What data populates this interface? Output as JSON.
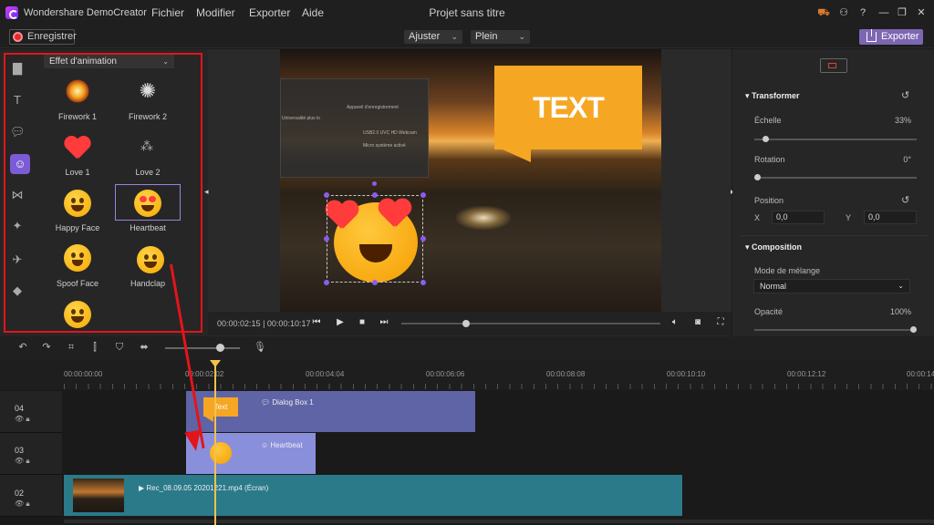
{
  "app": {
    "name": "Wondershare DemoCreator",
    "project_title": "Projet sans titre"
  },
  "menu": [
    "Fichier",
    "Modifier",
    "Exporter",
    "Aide"
  ],
  "toolbar": {
    "record_label": "Enregistrer",
    "fit_label": "Ajuster",
    "full_label": "Plein",
    "export_label": "Exporter"
  },
  "effects": {
    "category": "Effet d'animation",
    "items": [
      "Firework 1",
      "Firework 2",
      "Love 1",
      "Love 2",
      "Happy Face",
      "Heartbeat",
      "Spoof Face",
      "Handclap"
    ],
    "selected": "Heartbeat"
  },
  "preview": {
    "bubble_text": "TEXT",
    "overlay_title": "Appareil d'enregistrement",
    "overlay_cam": "USB2.0 UVC HD Webcam",
    "overlay_mic": "Micro système activé",
    "overlay_left": "Universalité plus lo"
  },
  "player": {
    "current": "00:00:02:15",
    "total": "00:00:10:17",
    "separator": "|"
  },
  "properties": {
    "transform_title": "Transformer",
    "scale_label": "Échelle",
    "scale_value": "33%",
    "rotation_label": "Rotation",
    "rotation_value": "0°",
    "position_label": "Position",
    "x_label": "X",
    "x_value": "0,0",
    "y_label": "Y",
    "y_value": "0,0",
    "composition_title": "Composition",
    "blend_label": "Mode de mélange",
    "blend_value": "Normal",
    "opacity_label": "Opacité",
    "opacity_value": "100%"
  },
  "timeline": {
    "ticks": [
      "00:00:00:00",
      "00:00:02:02",
      "00:00:04:04",
      "00:00:06:06",
      "00:00:08:08",
      "00:00:10:10",
      "00:00:12:12",
      "00:00:14:"
    ],
    "tracks": [
      {
        "num": "04"
      },
      {
        "num": "03"
      },
      {
        "num": "02"
      }
    ],
    "clips": {
      "dialog": "Dialog Box 1",
      "dialog_thumb": "Text",
      "heartbeat": "Heartbeat",
      "video": "Rec_08.09.05 20201221.mp4 (Écran)"
    }
  },
  "colors": {
    "accent": "#7d67b3",
    "highlight": "#e4141b",
    "bubble": "#f5a623",
    "playhead": "#f2c14e"
  }
}
